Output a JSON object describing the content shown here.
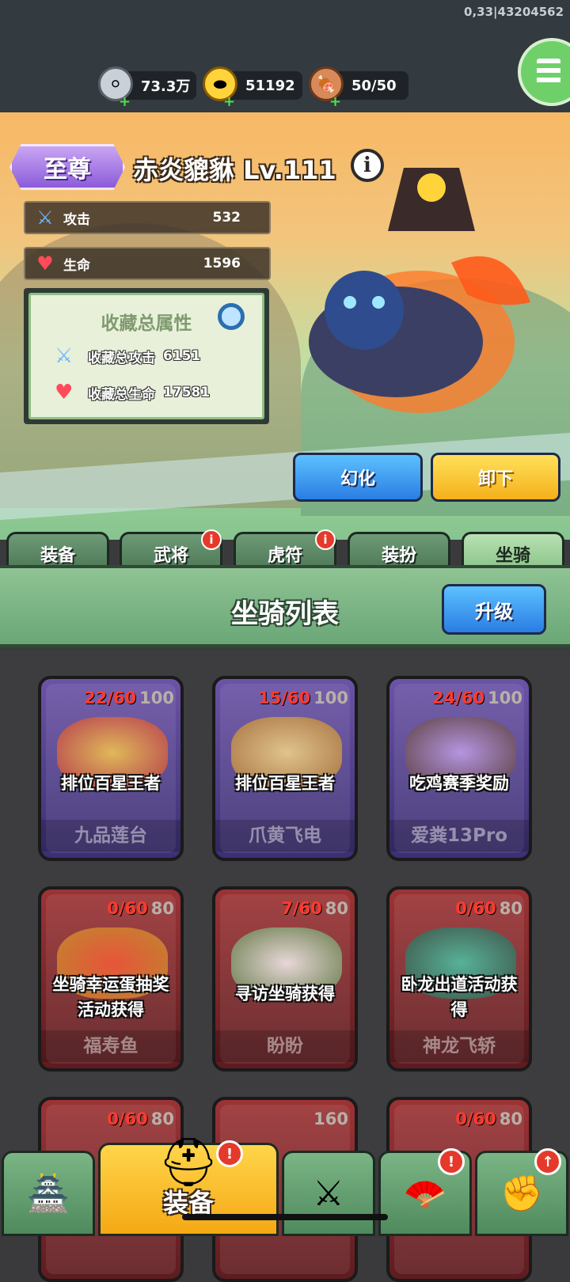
{
  "version": "0,33|43204562",
  "resources": [
    {
      "icon": "silver-coin-icon",
      "value": "73.3万"
    },
    {
      "icon": "gold-ingot-icon",
      "value": "51192"
    },
    {
      "icon": "meat-icon",
      "value": "50/50"
    }
  ],
  "mount": {
    "rank": "至尊",
    "name": "赤炎貔貅 Lv.111",
    "stats": [
      {
        "icon": "sword-icon",
        "label": "攻击",
        "value": "532"
      },
      {
        "icon": "heart-icon",
        "label": "生命",
        "value": "1596"
      }
    ]
  },
  "collection": {
    "title": "收藏总属性",
    "attack_label": "收藏总攻击",
    "attack_value": "6151",
    "hp_label": "收藏总生命",
    "hp_value": "17581"
  },
  "actions": {
    "transform": "幻化",
    "unequip": "卸下"
  },
  "tabs": [
    {
      "label": "装备",
      "badge": false
    },
    {
      "label": "武将",
      "badge": true
    },
    {
      "label": "虎符",
      "badge": true
    },
    {
      "label": "装扮",
      "badge": false
    },
    {
      "label": "坐骑",
      "badge": false,
      "active": true
    }
  ],
  "badge_glyph": "i",
  "list": {
    "title": "坐骑列表",
    "upgrade": "升级"
  },
  "cards": [
    {
      "current": "22/60",
      "max": "100",
      "how": "排位百星王者",
      "name": "九品莲台",
      "tier": "purple"
    },
    {
      "current": "15/60",
      "max": "100",
      "how": "排位百星王者",
      "name": "爪黄飞电",
      "tier": "purple"
    },
    {
      "current": "24/60",
      "max": "100",
      "how": "吃鸡赛季奖励",
      "name": "爱粪13Pro",
      "tier": "purple"
    },
    {
      "current": "0/60",
      "max": "80",
      "how": "坐骑幸运蛋抽奖活动获得",
      "name": "福寿鱼",
      "tier": "red"
    },
    {
      "current": "7/60",
      "max": "80",
      "how": "寻访坐骑获得",
      "name": "盼盼",
      "tier": "red"
    },
    {
      "current": "0/60",
      "max": "80",
      "how": "卧龙出道活动获得",
      "name": "神龙飞轿",
      "tier": "red"
    },
    {
      "current": "0/60",
      "max": "80",
      "how": "",
      "name": "",
      "tier": "red"
    },
    {
      "current": "",
      "max": "160",
      "how": "",
      "name": "",
      "tier": "red"
    },
    {
      "current": "0/60",
      "max": "80",
      "how": "",
      "name": "",
      "tier": "red"
    }
  ],
  "bottom_nav": {
    "active_label": "装备",
    "items": [
      "castle-icon",
      "helmet-icon",
      "shield-swords-icon",
      "fan-icon",
      "fist-icon"
    ]
  },
  "colors": {
    "accent_blue": "#2a7de3",
    "accent_yellow": "#f5b01a",
    "badge_red": "#e53a2b"
  }
}
